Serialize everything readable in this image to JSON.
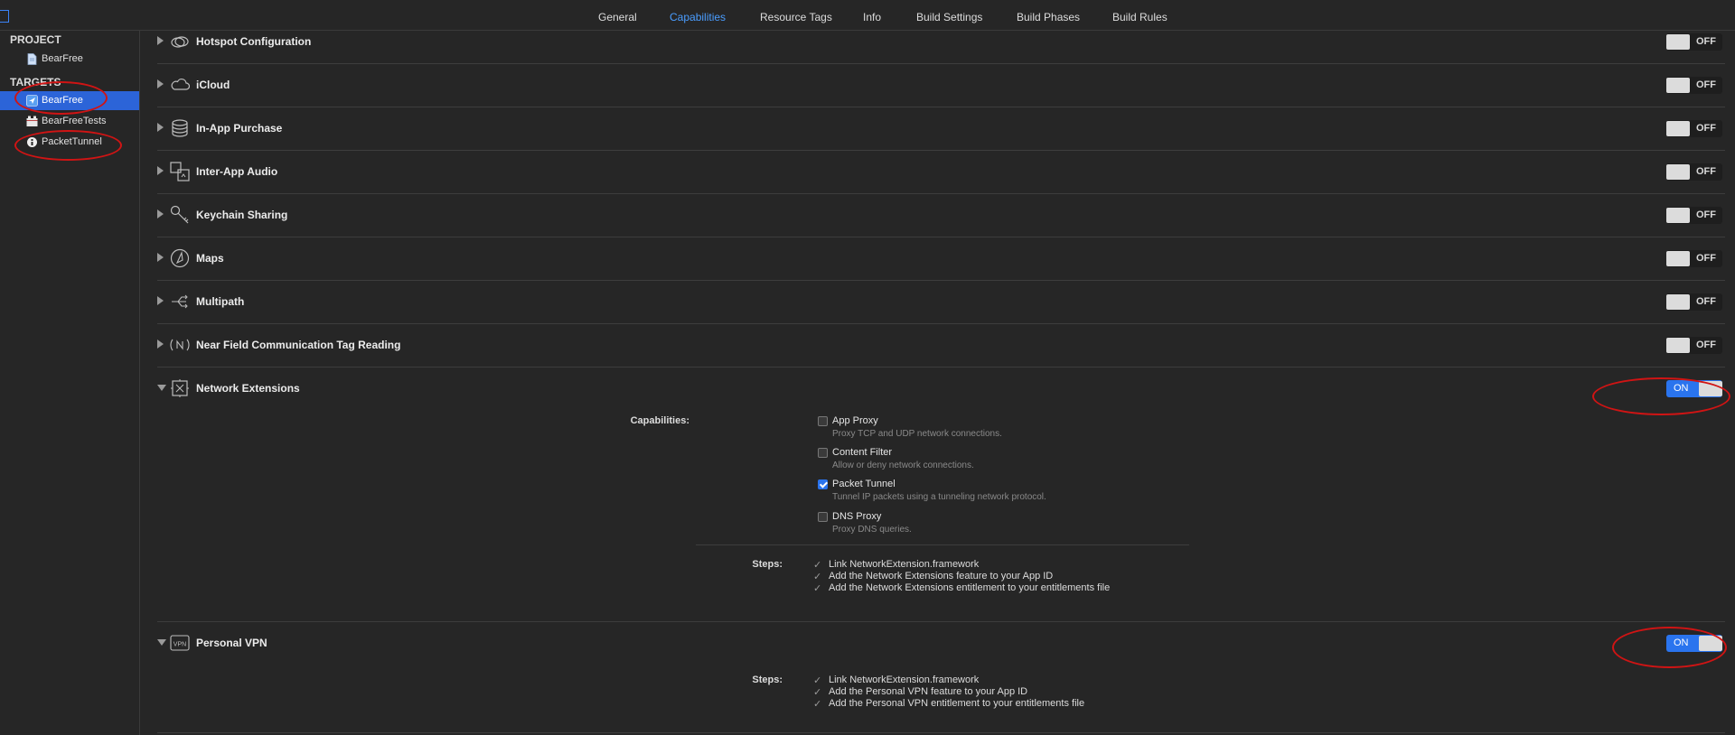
{
  "tabs": [
    {
      "label": "General",
      "active": false
    },
    {
      "label": "Capabilities",
      "active": true
    },
    {
      "label": "Resource Tags",
      "active": false
    },
    {
      "label": "Info",
      "active": false
    },
    {
      "label": "Build Settings",
      "active": false
    },
    {
      "label": "Build Phases",
      "active": false
    },
    {
      "label": "Build Rules",
      "active": false
    }
  ],
  "sidebar": {
    "project_header": "PROJECT",
    "project_item": "BearFree",
    "targets_header": "TARGETS",
    "targets": [
      {
        "label": "BearFree",
        "icon": "app-target-icon",
        "selected": true
      },
      {
        "label": "BearFreeTests",
        "icon": "test-bundle-icon",
        "selected": false
      },
      {
        "label": "PacketTunnel",
        "icon": "extension-icon",
        "selected": false
      }
    ]
  },
  "capabilities": [
    {
      "title": "Hotspot Configuration",
      "icon": "hotspot-icon",
      "state": "OFF"
    },
    {
      "title": "iCloud",
      "icon": "icloud-icon",
      "state": "OFF"
    },
    {
      "title": "In-App Purchase",
      "icon": "in-app-purchase-icon",
      "state": "OFF"
    },
    {
      "title": "Inter-App Audio",
      "icon": "inter-app-audio-icon",
      "state": "OFF"
    },
    {
      "title": "Keychain Sharing",
      "icon": "keychain-icon",
      "state": "OFF"
    },
    {
      "title": "Maps",
      "icon": "maps-icon",
      "state": "OFF"
    },
    {
      "title": "Multipath",
      "icon": "multipath-icon",
      "state": "OFF"
    },
    {
      "title": "Near Field Communication Tag Reading",
      "icon": "nfc-icon",
      "state": "OFF"
    },
    {
      "title": "Network Extensions",
      "icon": "network-extensions-icon",
      "state": "ON"
    },
    {
      "title": "Personal VPN",
      "icon": "vpn-icon",
      "state": "ON"
    }
  ],
  "network_extensions": {
    "capabilities_label": "Capabilities:",
    "options": [
      {
        "title": "App Proxy",
        "desc": "Proxy TCP and UDP network connections.",
        "checked": false
      },
      {
        "title": "Content Filter",
        "desc": "Allow or deny network connections.",
        "checked": false
      },
      {
        "title": "Packet Tunnel",
        "desc": "Tunnel IP packets using a tunneling network protocol.",
        "checked": true
      },
      {
        "title": "DNS Proxy",
        "desc": "Proxy DNS queries.",
        "checked": false
      }
    ],
    "steps_label": "Steps:",
    "steps": [
      "Link NetworkExtension.framework",
      "Add the Network Extensions feature to your App ID",
      "Add the Network Extensions entitlement to your entitlements file"
    ]
  },
  "personal_vpn": {
    "steps_label": "Steps:",
    "steps": [
      "Link NetworkExtension.framework",
      "Add the Personal VPN feature to your App ID",
      "Add the Personal VPN entitlement to your entitlements file"
    ]
  },
  "check_glyph": "✓",
  "colors": {
    "accent": "#2a74ee",
    "annotation": "#d01414"
  }
}
